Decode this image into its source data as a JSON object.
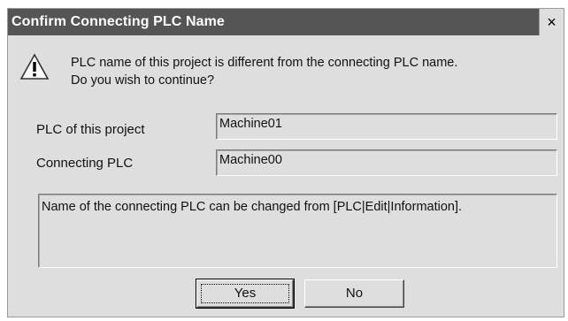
{
  "dialog": {
    "title": "Confirm Connecting PLC Name",
    "close_label": "×",
    "message_line1": "PLC name of this project is different from the connecting PLC name.",
    "message_line2": "Do you wish to continue?",
    "project_plc_label": "PLC of this project",
    "project_plc_value": "Machine01",
    "connecting_plc_label": "Connecting PLC",
    "connecting_plc_value": "Machine00",
    "info_text": "Name of the connecting PLC can be changed from [PLC|Edit|Information].",
    "yes_label": "Yes",
    "no_label": "No"
  },
  "icons": {
    "warning": "warning-triangle-icon",
    "close": "close-icon"
  },
  "colors": {
    "titlebar": "#555555",
    "dialog_bg": "#dedede"
  }
}
